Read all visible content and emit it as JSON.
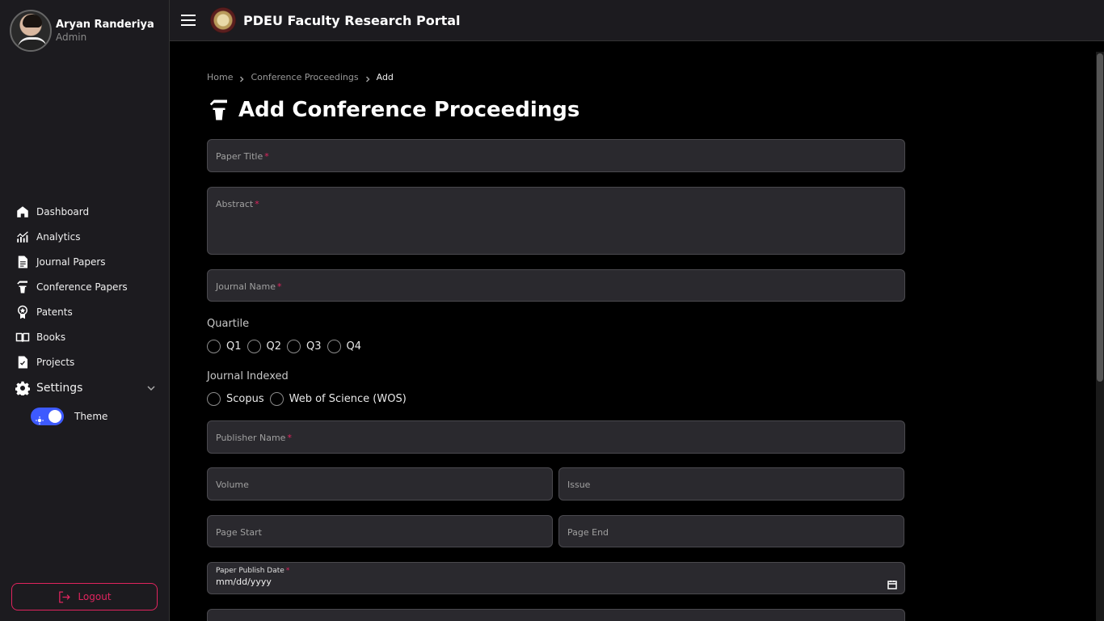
{
  "sidebar": {
    "user_name": "Aryan Randeriya",
    "user_role": "Admin",
    "items": [
      {
        "label": "Dashboard",
        "icon": "home-icon"
      },
      {
        "label": "Analytics",
        "icon": "analytics-icon"
      },
      {
        "label": "Journal Papers",
        "icon": "document-icon"
      },
      {
        "label": "Conference Papers",
        "icon": "podium-icon"
      },
      {
        "label": "Patents",
        "icon": "award-icon"
      },
      {
        "label": "Books",
        "icon": "book-icon"
      },
      {
        "label": "Projects",
        "icon": "project-icon"
      }
    ],
    "settings_label": "Settings",
    "theme_label": "Theme",
    "logout_label": "Logout"
  },
  "topbar": {
    "title": "PDEU Faculty Research Portal"
  },
  "breadcrumb": {
    "home": "Home",
    "section": "Conference Proceedings",
    "current": "Add"
  },
  "page": {
    "title": "Add Conference Proceedings"
  },
  "form": {
    "paper_title": "Paper Title",
    "abstract": "Abstract",
    "journal_name": "Journal Name",
    "quartile_label": "Quartile",
    "quartile_options": [
      "Q1",
      "Q2",
      "Q3",
      "Q4"
    ],
    "indexed_label": "Journal Indexed",
    "indexed_options": [
      "Scopus",
      "Web of Science (WOS)"
    ],
    "publisher_name": "Publisher Name",
    "volume": "Volume",
    "issue": "Issue",
    "page_start": "Page Start",
    "page_end": "Page End",
    "publish_date_label": "Paper Publish Date",
    "publish_date_value": "mm/dd/yyyy",
    "required_mark": "*"
  },
  "colors": {
    "accent": "#3d5afe",
    "danger": "#e0245e",
    "surface": "#1c1b1f",
    "field": "#2a292e"
  }
}
